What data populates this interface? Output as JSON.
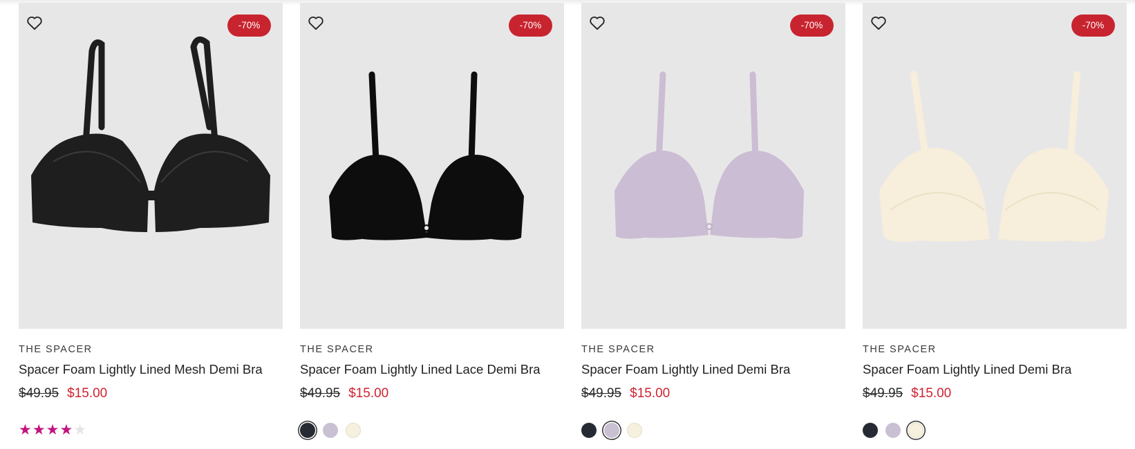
{
  "products": [
    {
      "brand": "THE SPACER",
      "name": "Spacer Foam Lightly Lined Mesh Demi Bra",
      "was_price": "$49.95",
      "price": "$15.00",
      "badge": "-70%",
      "color": "#1e1e1e",
      "rating": 4,
      "rating_max": 5,
      "swatches": []
    },
    {
      "brand": "THE SPACER",
      "name": "Spacer Foam Lightly Lined Lace Demi Bra",
      "was_price": "$49.95",
      "price": "$15.00",
      "badge": "-70%",
      "color": "#0d0d0d",
      "swatches": [
        {
          "name": "black",
          "hex": "#262a33",
          "selected": true
        },
        {
          "name": "lilac",
          "hex": "#c9c0d4",
          "selected": false
        },
        {
          "name": "cream",
          "hex": "#f6f0de",
          "selected": false
        }
      ]
    },
    {
      "brand": "THE SPACER",
      "name": "Spacer Foam Lightly Lined Demi Bra",
      "was_price": "$49.95",
      "price": "$15.00",
      "badge": "-70%",
      "color": "#cbbdd3",
      "swatches": [
        {
          "name": "black",
          "hex": "#262a33",
          "selected": false
        },
        {
          "name": "lilac",
          "hex": "#c9c0d4",
          "selected": true
        },
        {
          "name": "cream",
          "hex": "#f6f0de",
          "selected": false
        }
      ]
    },
    {
      "brand": "THE SPACER",
      "name": "Spacer Foam Lightly Lined Demi Bra",
      "was_price": "$49.95",
      "price": "$15.00",
      "badge": "-70%",
      "color": "#f7efdb",
      "swatches": [
        {
          "name": "black",
          "hex": "#262a33",
          "selected": false
        },
        {
          "name": "lilac",
          "hex": "#c9c0d4",
          "selected": false
        },
        {
          "name": "cream",
          "hex": "#f6f0de",
          "selected": true
        }
      ]
    }
  ],
  "icons": {
    "wishlist": "heart-outline-icon",
    "rating": "star-icon"
  },
  "colors": {
    "sale_red": "#d0222f",
    "badge_red": "#c8242f",
    "star_pink": "#c2147e"
  }
}
